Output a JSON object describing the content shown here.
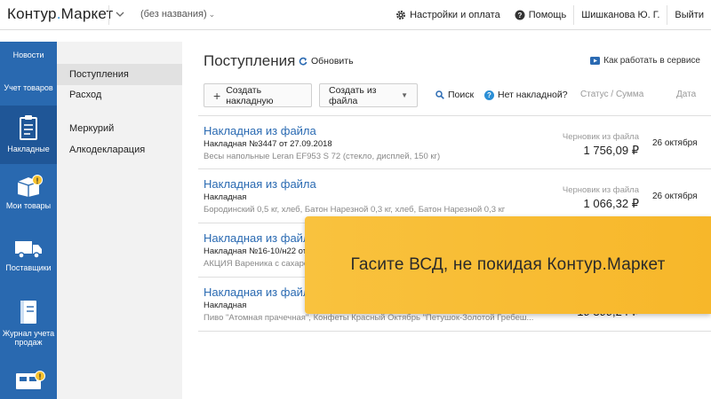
{
  "header": {
    "logo_main": "Контур",
    "logo_dot": ".",
    "logo_sub": "Маркет",
    "doc_name": "(без названия)",
    "settings_label": "Настройки и оплата",
    "help_label": "Помощь",
    "user_name": "Шишканова Ю. Г.",
    "logout_label": "Выйти"
  },
  "sidebar": {
    "items": [
      {
        "label": "Новости"
      },
      {
        "label": "Учет товаров"
      },
      {
        "label": "Накладные"
      },
      {
        "label": "Мои товары",
        "badge": "!"
      },
      {
        "label": "Поставщики"
      },
      {
        "label": "Журнал учета продаж"
      },
      {
        "label": "",
        "badge": "!"
      }
    ]
  },
  "subnav": {
    "items": [
      {
        "label": "Поступления"
      },
      {
        "label": "Расход"
      },
      {
        "label": "Меркурий"
      },
      {
        "label": "Алкодекларация"
      }
    ]
  },
  "main": {
    "title": "Поступления",
    "refresh_label": "Обновить",
    "howto_label": "Как работать в сервисе",
    "create_button": "Создать накладную",
    "from_file_button": "Создать из файла",
    "search_label": "Поиск",
    "no_invoice_label": "Нет накладной?",
    "col_status": "Статус / Сумма",
    "col_date": "Дата",
    "rows": [
      {
        "title": "Накладная из файла",
        "sub": "Накладная №3447 от 27.09.2018",
        "desc": "Весы напольные Leran EF953 S 72 (стекло, дисплей, 150 кг)",
        "status": "Черновик из файла",
        "sum": "1 756,09 ₽",
        "date": "26 октября"
      },
      {
        "title": "Накладная из файла",
        "sub": "Накладная",
        "desc": "Бородинский 0,5 кг, хлеб, Батон Нарезной 0,3 кг, хлеб, Батон Нарезной 0,3 кг",
        "status": "Черновик из файла",
        "sum": "1 066,32 ₽",
        "date": "26 октября"
      },
      {
        "title": "Накладная из файла",
        "sub": "Накладная №16-10/н22 от",
        "desc": "АКЦИЯ Вареника с сахаро",
        "status": "",
        "sum": "",
        "date": ""
      },
      {
        "title": "Накладная из файла",
        "sub": "Накладная",
        "desc": "Пиво \"Атомная прачечная\", Конфеты Красный Октябрь \"Петушок-Золотой Гребеш...",
        "status": "",
        "sum": "19 399,24 ₽",
        "date": ""
      }
    ]
  },
  "banner": {
    "text": "Гасите ВСД, не покидая Контур.Маркет"
  },
  "colors": {
    "sidebar_bg": "#2969b0",
    "sidebar_active": "#1f5697",
    "link_blue": "#2a6ab2",
    "banner_yellow": "#f9c23e"
  }
}
